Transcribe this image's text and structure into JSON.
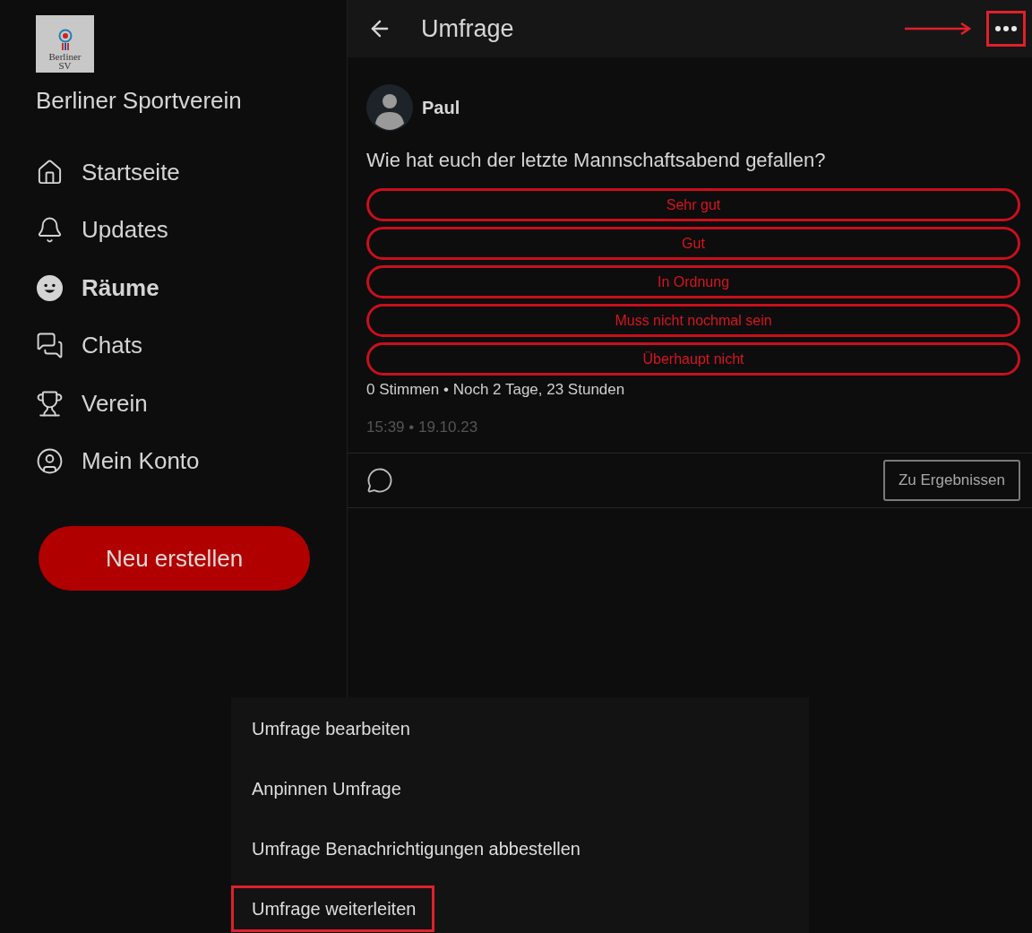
{
  "sidebar": {
    "logo": {
      "lines": [
        "Berliner",
        "SV"
      ]
    },
    "club_name": "Berliner Sportverein",
    "items": [
      {
        "label": "Startseite",
        "selected": false
      },
      {
        "label": "Updates",
        "selected": false
      },
      {
        "label": "Räume",
        "selected": true
      },
      {
        "label": "Chats",
        "selected": false
      },
      {
        "label": "Verein",
        "selected": false
      },
      {
        "label": "Mein Konto",
        "selected": false
      }
    ],
    "create_button": "Neu erstellen"
  },
  "header": {
    "title": "Umfrage",
    "more_highlighted": true
  },
  "post": {
    "author": "Paul",
    "question": "Wie hat euch der letzte Mannschaftsabend gefallen?",
    "options": [
      "Sehr gut",
      "Gut",
      "In Ordnung",
      "Muss nicht nochmal sein",
      "Überhaupt nicht"
    ],
    "summary": "0 Stimmen • Noch 2 Tage, 23 Stunden",
    "timestamp": "15:39 • 19.10.23",
    "results_button": "Zu Ergebnissen"
  },
  "menu": {
    "items": [
      {
        "label": "Umfrage bearbeiten",
        "highlighted": false
      },
      {
        "label": "Anpinnen Umfrage",
        "highlighted": false
      },
      {
        "label": "Umfrage Benachrichtigungen abbestellen",
        "highlighted": false
      },
      {
        "label": "Umfrage weiterleiten",
        "highlighted": true
      }
    ]
  }
}
